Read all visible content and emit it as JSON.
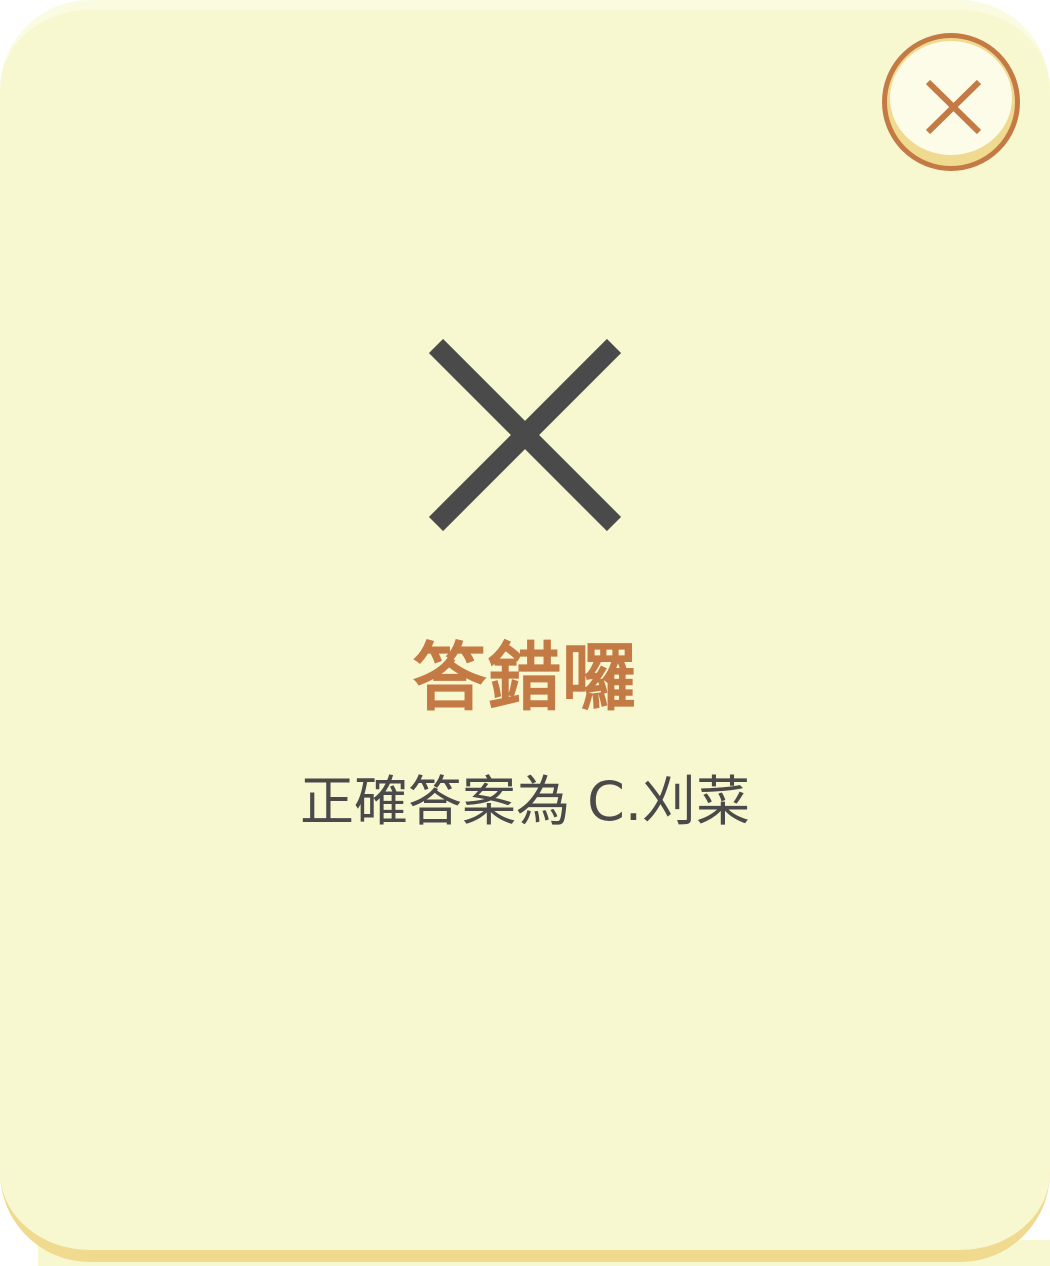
{
  "dialog": {
    "title": "答錯囉",
    "message": "正確答案為 C.刈菜"
  },
  "icons": {
    "close": "close-icon",
    "result": "wrong-answer-x-icon"
  },
  "colors": {
    "card_background": "#f7f7d0",
    "card_shadow": "#f0da8f",
    "accent": "#c47a45",
    "text": "#4a4a4a",
    "mark": "#4a4a4a"
  }
}
